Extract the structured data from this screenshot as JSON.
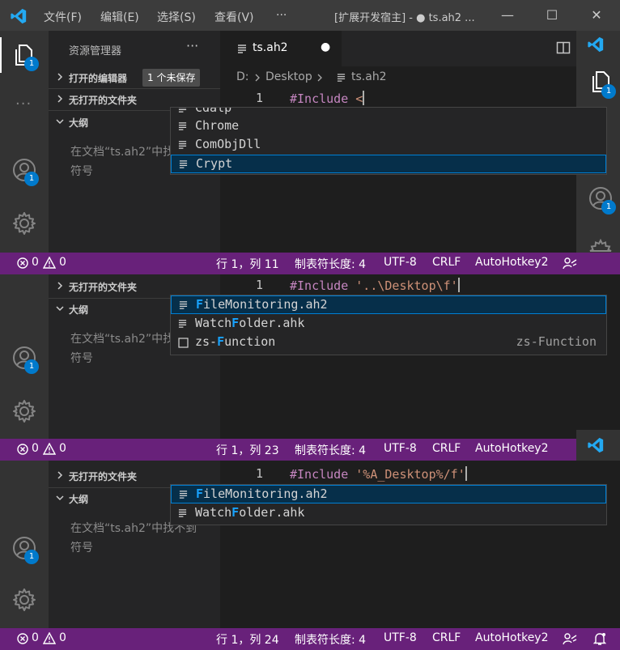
{
  "titlebar": {
    "menus": [
      "文件(F)",
      "编辑(E)",
      "选择(S)",
      "查看(V)",
      "···"
    ],
    "title": "[扩展开发宿主] - ● ts.ah2 ...",
    "minimize": "—",
    "maximize": "☐",
    "close": "✕"
  },
  "activity": {
    "explorer_badge": "1",
    "accounts_badge": "1",
    "more": "···"
  },
  "sidebar": {
    "title": "资源管理器",
    "more": "···",
    "open_editors": "打开的编辑器",
    "unsaved_badge": "1 个未保存",
    "no_folder": "无打开的文件夹",
    "outline": "大纲",
    "outline_msg": "在文档“ts.ah2”中找不到符号"
  },
  "tab": {
    "label": "ts.ah2",
    "dirty": "●"
  },
  "breadcrumb": {
    "drive": "D:",
    "folder": "Desktop",
    "file": "ts.ah2"
  },
  "panels": [
    {
      "line_no": "1",
      "directive": "#Include",
      "arg": " <",
      "suggestions": [
        {
          "pre": "",
          "hl": "",
          "post": "Cdalp",
          "detail": ""
        },
        {
          "pre": "",
          "hl": "",
          "post": "Chrome",
          "detail": ""
        },
        {
          "pre": "",
          "hl": "",
          "post": "ComObjDll",
          "detail": ""
        },
        {
          "pre": "",
          "hl": "",
          "post": "Crypt",
          "detail": ""
        }
      ],
      "status": {
        "errors": "0",
        "warnings": "0",
        "position": "行 1，列 11",
        "tab_size": "制表符长度: 4",
        "encoding": "UTF-8",
        "eol": "CRLF",
        "language": "AutoHotkey2"
      }
    },
    {
      "line_no": "1",
      "directive": "#Include",
      "arg": " '..\\Desktop\\f'",
      "suggestions": [
        {
          "pre": "",
          "hl": "F",
          "post": "ileMonitoring.ah2",
          "detail": ""
        },
        {
          "pre": "Watch",
          "hl": "F",
          "post": "older.ahk",
          "detail": ""
        },
        {
          "pre": "zs-",
          "hl": "F",
          "post": "unction",
          "detail": "zs-Function"
        }
      ],
      "status": {
        "errors": "0",
        "warnings": "0",
        "position": "行 1，列 23",
        "tab_size": "制表符长度: 4",
        "encoding": "UTF-8",
        "eol": "CRLF",
        "language": "AutoHotkey2"
      }
    },
    {
      "line_no": "1",
      "directive": "#Include",
      "arg": " '%A_Desktop%/f'",
      "suggestions": [
        {
          "pre": "",
          "hl": "F",
          "post": "ileMonitoring.ah2",
          "detail": ""
        },
        {
          "pre": "Watch",
          "hl": "F",
          "post": "older.ahk",
          "detail": ""
        }
      ],
      "status": {
        "errors": "0",
        "warnings": "0",
        "position": "行 1，列 24",
        "tab_size": "制表符长度: 4",
        "encoding": "UTF-8",
        "eol": "CRLF",
        "language": "AutoHotkey2"
      }
    }
  ],
  "colors": {
    "statusbar": "#68217a",
    "accent": "#007acc",
    "selection": "#062f4a",
    "match_highlight": "#18a3ff"
  }
}
